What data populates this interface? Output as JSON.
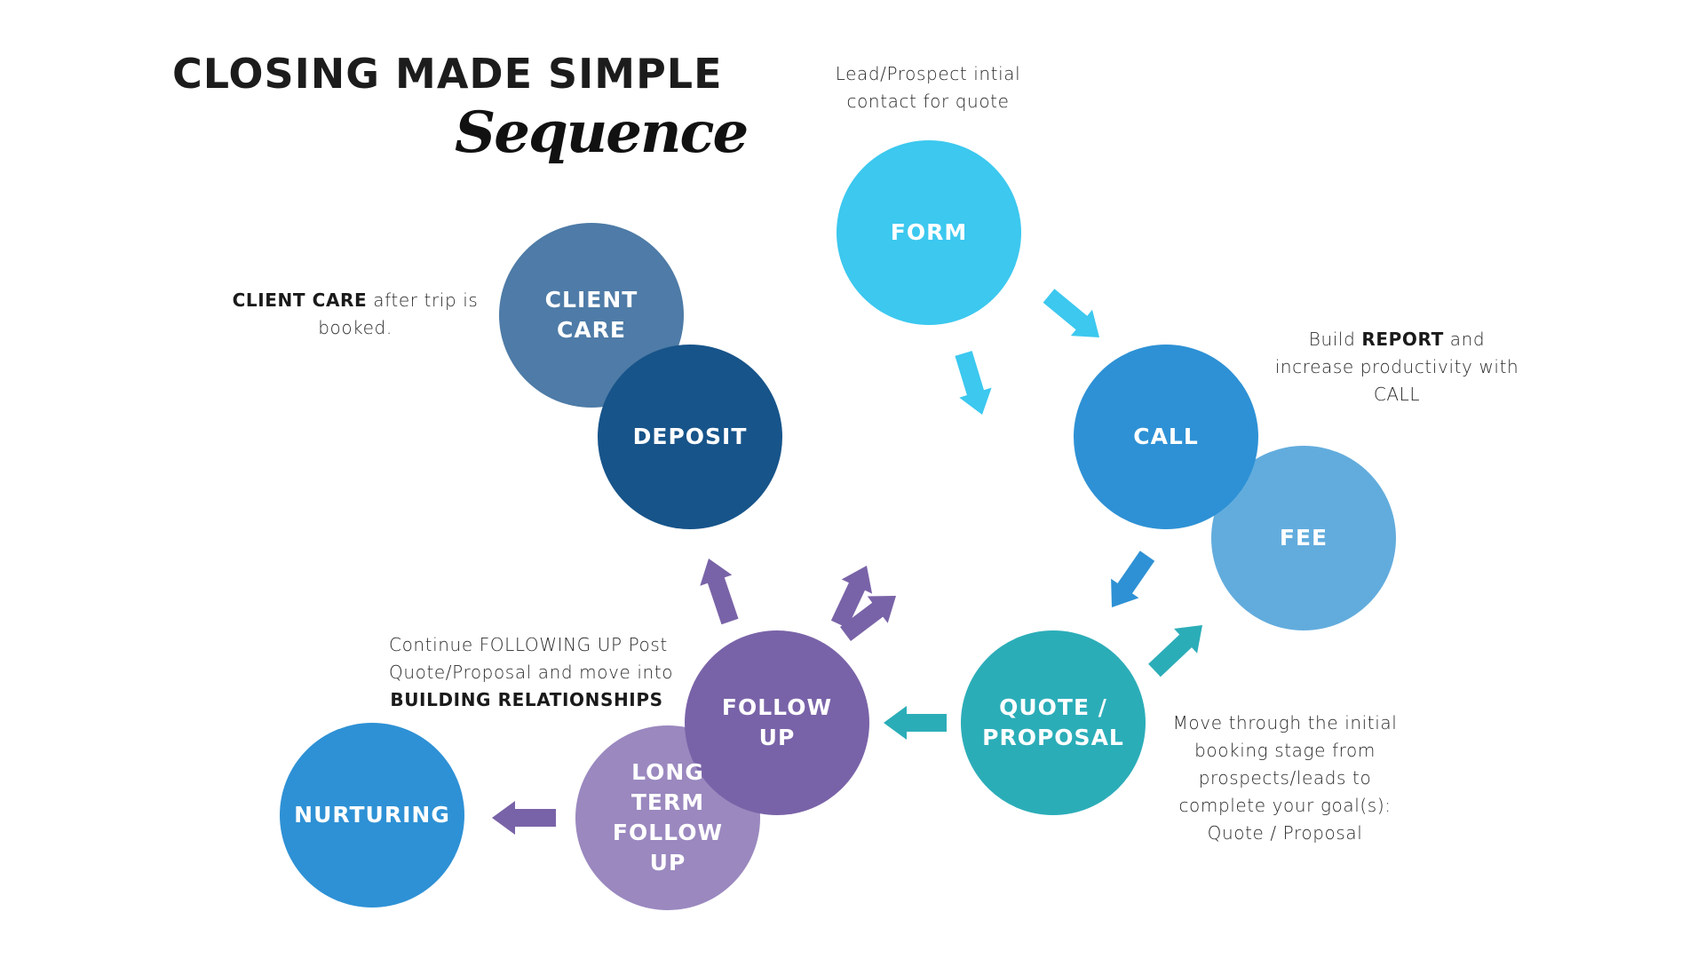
{
  "header": {
    "title": "CLOSING MADE SIMPLE",
    "subtitle": "Sequence"
  },
  "colors": {
    "form": "#3CC8EF",
    "client_care": "#4E7BA7",
    "deposit": "#17548A",
    "call": "#2E91D5",
    "fee": "#62ACDD",
    "quote": "#2BADB8",
    "follow_up": "#7963A8",
    "long_term": "#9A88BF",
    "nurturing": "#2E91D5",
    "text": "#1c1c1c",
    "label_text": "#ffffff"
  },
  "nodes": {
    "form": {
      "label": "FORM"
    },
    "client_care": {
      "label": "CLIENT\nCARE"
    },
    "deposit": {
      "label": "DEPOSIT"
    },
    "call": {
      "label": "CALL"
    },
    "fee": {
      "label": "FEE"
    },
    "quote": {
      "label": "QUOTE /\nPROPOSAL"
    },
    "follow_up": {
      "label": "FOLLOW\nUP"
    },
    "long_term": {
      "label": "LONG\nTERM\nFOLLOW\nUP"
    },
    "nurturing": {
      "label": "NURTURING"
    }
  },
  "notes": {
    "form": {
      "line1": "Lead/Prospect intial",
      "line2": "contact for quote"
    },
    "client_care": {
      "bold": "CLIENT CARE",
      "line1_rest": " after trip is",
      "line2": "booked."
    },
    "call": {
      "line1_pre": "Build ",
      "bold": "REPORT",
      "line1_post": " and",
      "line2": "increase productivity with",
      "line3": "CALL"
    },
    "follow_up": {
      "line1": "Continue FOLLOWING UP Post",
      "line2": "Quote/Proposal and move into",
      "bold": "BUILDING RELATIONSHIPS"
    },
    "quote": {
      "line1": "Move through the initial",
      "line2": "booking stage from",
      "line3": "prospects/leads to",
      "line4": "complete your goal(s):",
      "line5": "Quote / Proposal"
    }
  },
  "arrows": [
    {
      "name": "form-to-call-arrow",
      "from": "form",
      "to": "call",
      "color": "#3CC8EF"
    },
    {
      "name": "form-down-arrow",
      "from": "form",
      "to": "quote",
      "color": "#3CC8EF"
    },
    {
      "name": "call-to-quote-arrow",
      "from": "call",
      "to": "quote",
      "color": "#2E91D5"
    },
    {
      "name": "quote-to-fee-arrow",
      "from": "quote",
      "to": "fee",
      "color": "#2BADB8"
    },
    {
      "name": "quote-to-follow-up-arrow",
      "from": "quote",
      "to": "follow_up",
      "color": "#2BADB8"
    },
    {
      "name": "follow-up-to-deposit-arrow",
      "from": "follow_up",
      "to": "deposit",
      "color": "#7963A8"
    },
    {
      "name": "follow-up-up-arrow-1",
      "from": "follow_up",
      "to": "",
      "color": "#7963A8"
    },
    {
      "name": "follow-up-up-arrow-2",
      "from": "follow_up",
      "to": "",
      "color": "#7963A8"
    },
    {
      "name": "long-term-to-nurturing-arrow",
      "from": "long_term",
      "to": "nurturing",
      "color": "#7963A8"
    }
  ]
}
